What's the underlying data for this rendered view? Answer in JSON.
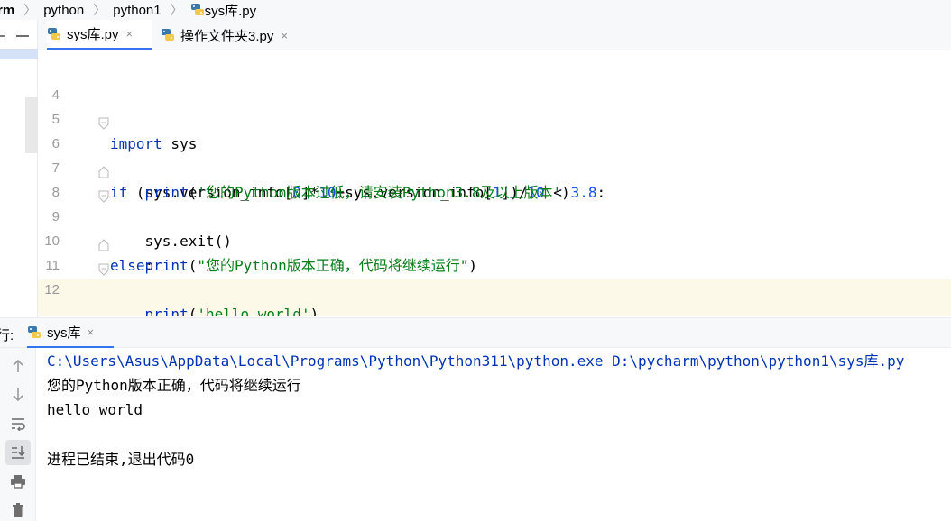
{
  "breadcrumb": {
    "items": [
      "rm",
      "python",
      "python1",
      "sys库.py"
    ]
  },
  "tabs": [
    {
      "label": "sys库.py",
      "close": "×",
      "active": true
    },
    {
      "label": "操作文件夹3.py",
      "close": "×",
      "active": false
    }
  ],
  "editor": {
    "lines": [
      {
        "num": "4",
        "code": ""
      },
      {
        "num": "5",
        "code": "import sys"
      },
      {
        "num": "6",
        "code": "if (sys.version_info[0]*10+sys.version_info[1])/10 < 3.8:"
      },
      {
        "num": "7",
        "code": "    print('您的Python版本过低，请安装Python3.8及以上版本')"
      },
      {
        "num": "8",
        "code": "    sys.exit()"
      },
      {
        "num": "9",
        "code": "else:"
      },
      {
        "num": "10",
        "code": "    print(\"您的Python版本正确，代码将继续运行\")"
      },
      {
        "num": "11",
        "code": "    print('hello world')"
      },
      {
        "num": "12",
        "code": "#"
      }
    ]
  },
  "run_panel": {
    "label": "行:",
    "tab_label": "sys库",
    "tab_close": "×",
    "output": [
      "C:\\Users\\Asus\\AppData\\Local\\Programs\\Python\\Python311\\python.exe D:\\pycharm\\python\\python1\\sys库.py",
      "您的Python版本正确，代码将继续运行",
      "hello world",
      "",
      "进程已结束,退出代码0"
    ]
  },
  "colors": {
    "keyword": "#0033b3",
    "number": "#1750eb",
    "string": "#067d17",
    "accent": "#3574f0"
  }
}
